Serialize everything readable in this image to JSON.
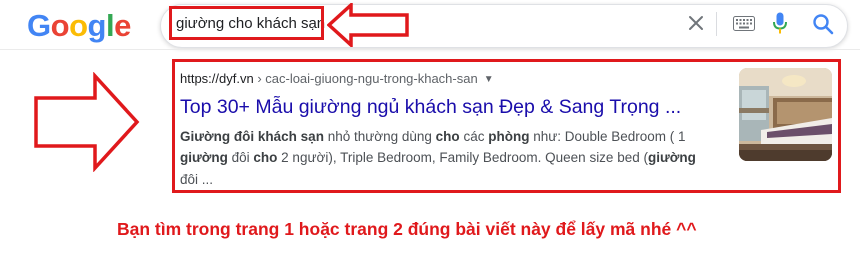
{
  "logo": {
    "letters": [
      "G",
      "o",
      "o",
      "g",
      "l",
      "e"
    ],
    "colors": [
      "#4285f4",
      "#ea4335",
      "#fbbc05",
      "#4285f4",
      "#34a853",
      "#ea4335"
    ]
  },
  "search": {
    "query": "giường cho khách sạn"
  },
  "result": {
    "url_domain": "https://dyf.vn",
    "url_path": " › cac-loai-giuong-ngu-trong-khach-san",
    "url_caret": "▼",
    "title": "Top 30+ Mẫu giường ngủ khách sạn Đẹp & Sang Trọng ...",
    "snippet": {
      "l1": [
        "Giường",
        " ",
        "đôi",
        " ",
        "khách sạn",
        " nhỏ thường dùng ",
        "cho",
        " các ",
        "phòng",
        " như: Double Bedroom ( 1"
      ],
      "l2": [
        "giường",
        " đôi ",
        "cho",
        " 2 người), Triple Bedroom, Family Bedroom. Queen size bed (",
        "giường"
      ],
      "l3": [
        "đôi ..."
      ]
    }
  },
  "caption": "Bạn tìm trong trang 1 hoặc trang 2 đúng bài viết này để lấy mã nhé ^^",
  "colors": {
    "annotation_red": "#e0191c",
    "link_blue": "#1a0dab",
    "snippet_gray": "#4d5156"
  }
}
